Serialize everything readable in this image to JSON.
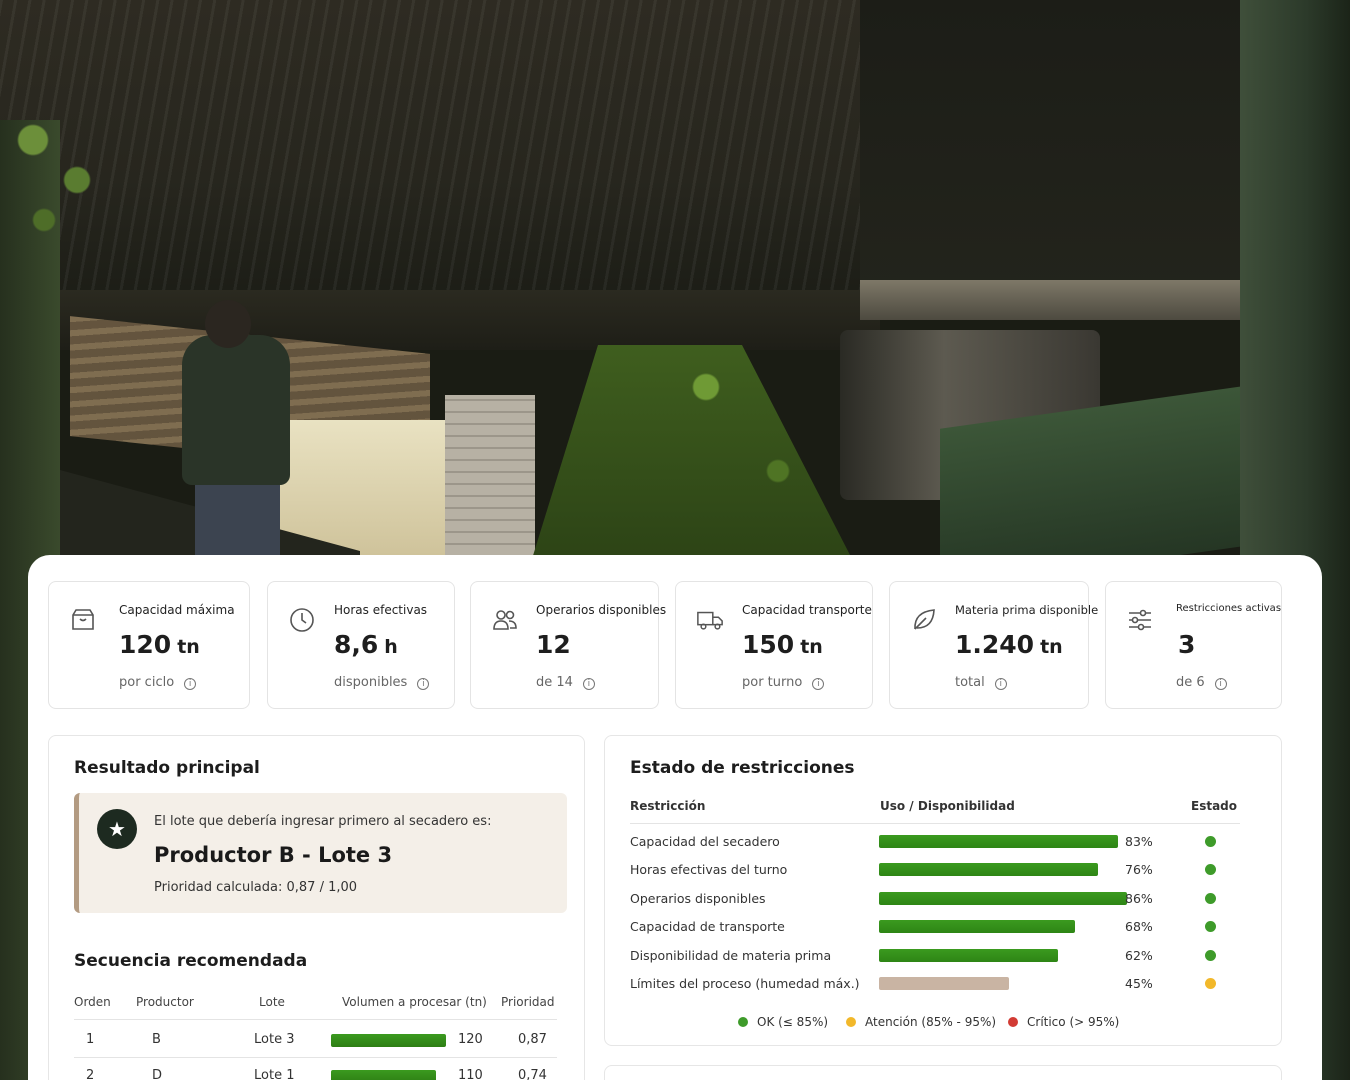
{
  "colors": {
    "ok": "#3e9b2a",
    "attention": "#f2b82a",
    "critical": "#d23b34",
    "bar_green": "#2e8515",
    "bar_tan": "#c9b4a3",
    "accent_border": "#b39b82"
  },
  "kpis": [
    {
      "icon": "package-icon",
      "label": "Capacidad máxima",
      "value": "120",
      "unit": "tn",
      "sub": "por ciclo"
    },
    {
      "icon": "clock-icon",
      "label": "Horas efectivas",
      "value": "8,6",
      "unit": "h",
      "sub": "disponibles"
    },
    {
      "icon": "users-icon",
      "label": "Operarios disponibles",
      "value": "12",
      "unit": "",
      "sub": "de 14"
    },
    {
      "icon": "truck-icon",
      "label": "Capacidad transporte",
      "value": "150",
      "unit": "tn",
      "sub": "por turno"
    },
    {
      "icon": "leaf-icon",
      "label": "Materia prima disponible",
      "value": "1.240",
      "unit": "tn",
      "sub": "total"
    },
    {
      "icon": "sliders-icon",
      "label": "Restricciones activas",
      "value": "3",
      "unit": "",
      "sub": "de 6"
    }
  ],
  "result": {
    "title": "Resultado principal",
    "lead": "El lote que debería ingresar primero al secadero es:",
    "main": "Productor B - Lote 3",
    "priority": "Prioridad calculada: 0,87 / 1,00"
  },
  "sequence": {
    "title": "Secuencia recomendada",
    "headers": [
      "Orden",
      "Productor",
      "Lote",
      "Volumen a procesar (tn)",
      "Prioridad"
    ],
    "rows": [
      {
        "order": "1",
        "producer": "B",
        "lot": "Lote 3",
        "volume": 120,
        "volume_label": "120",
        "priority": "0,87"
      },
      {
        "order": "2",
        "producer": "D",
        "lot": "Lote 1",
        "volume": 110,
        "volume_label": "110",
        "priority": "0,74"
      }
    ],
    "volume_max": 120
  },
  "restrictions": {
    "title": "Estado de restricciones",
    "headers": [
      "Restricción",
      "Uso / Disponibilidad",
      "Estado"
    ],
    "rows": [
      {
        "label": "Capacidad del secadero",
        "value": 83,
        "pct": "83%",
        "status": "ok"
      },
      {
        "label": "Horas efectivas del turno",
        "value": 76,
        "pct": "76%",
        "status": "ok"
      },
      {
        "label": "Operarios disponibles",
        "value": 86,
        "pct": "86%",
        "status": "ok"
      },
      {
        "label": "Capacidad de transporte",
        "value": 68,
        "pct": "68%",
        "status": "ok"
      },
      {
        "label": "Disponibilidad de materia prima",
        "value": 62,
        "pct": "62%",
        "status": "ok"
      },
      {
        "label": "Límites del proceso (humedad máx.)",
        "value": 45,
        "pct": "45%",
        "status": "attention"
      }
    ],
    "legend": [
      "OK (≤ 85%)",
      "Atención (85% - 95%)",
      "Crítico (> 95%)"
    ]
  }
}
